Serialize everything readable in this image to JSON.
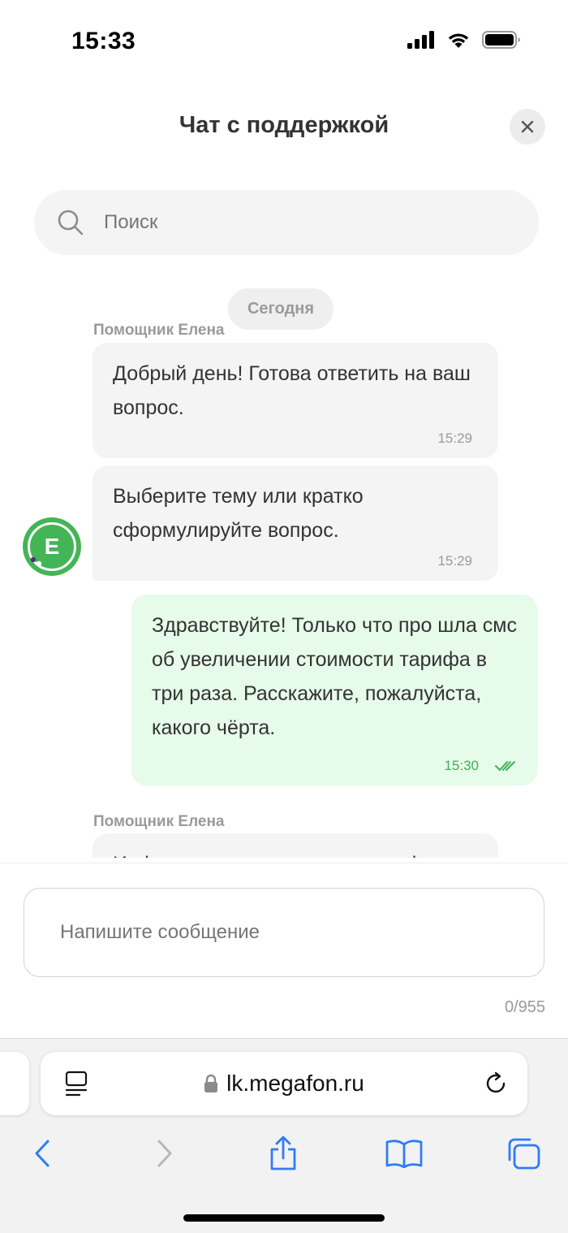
{
  "status_bar": {
    "time": "15:33"
  },
  "header": {
    "title": "Чат с поддержкой"
  },
  "search": {
    "placeholder": "Поиск"
  },
  "chat": {
    "date_separator": "Сегодня",
    "assistant_name": "Помощник Елена",
    "avatar_letter": "Е",
    "messages": [
      {
        "direction": "incoming",
        "text": "Добрый день! Готова ответить на ваш вопрос.",
        "time": "15:29"
      },
      {
        "direction": "incoming",
        "text": "Выберите тему или кратко сформулируйте вопрос.",
        "time": "15:29"
      },
      {
        "direction": "outgoing",
        "text": "Здравствуйте! Только что про шла смс об увеличении стоимости тарифа в три раза. Расскажите, пожалуйста, какого чёрта.",
        "time": "15:30",
        "status": "read"
      }
    ],
    "next_sender_name": "Помощник Елена",
    "next_message_partial": "Информация о стоимости тарифа"
  },
  "composer": {
    "placeholder": "Напишите сообщение",
    "counter": "0/955"
  },
  "browser": {
    "url": "lk.megafon.ru"
  },
  "colors": {
    "accent_green": "#44b556",
    "outgoing_bubble": "#e6fbe9",
    "incoming_bubble": "#f4f4f4",
    "ios_blue": "#2f7cf6"
  }
}
